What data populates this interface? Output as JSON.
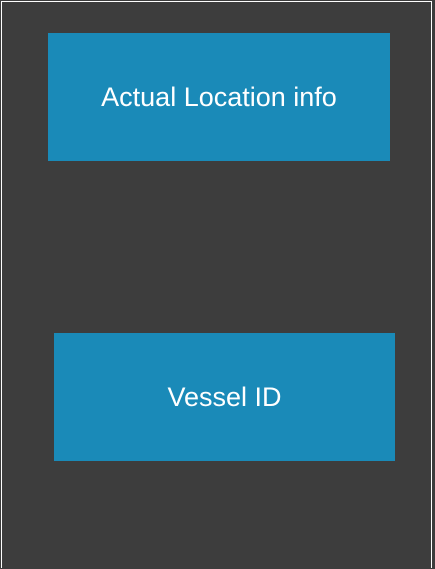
{
  "colors": {
    "background": "#3d3d3d",
    "box_fill": "#1a8ab8",
    "border": "#ffffff",
    "text": "#ffffff"
  },
  "boxes": [
    {
      "label": "Actual Location info"
    },
    {
      "label": "Vessel ID"
    }
  ]
}
